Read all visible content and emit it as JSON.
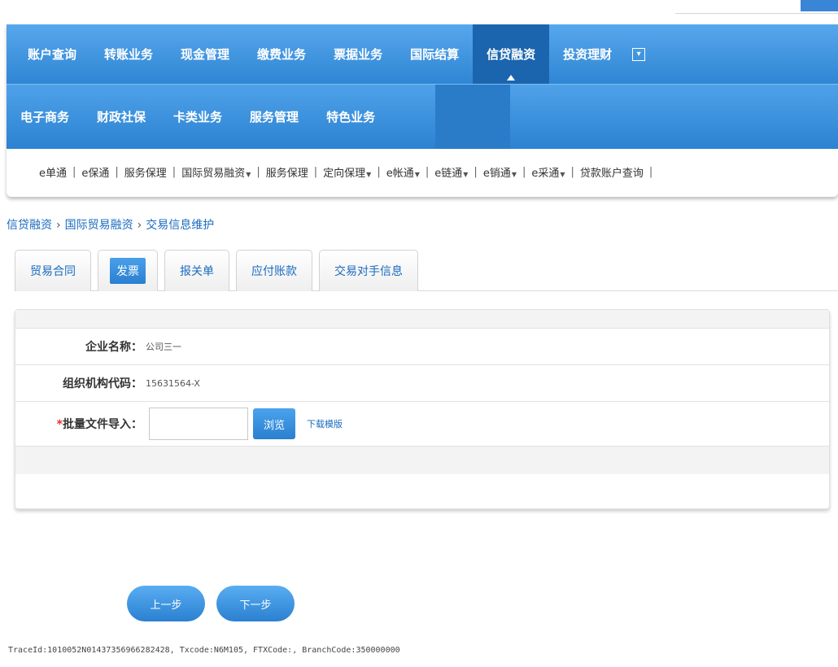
{
  "nav_primary": [
    "账户查询",
    "转账业务",
    "现金管理",
    "缴费业务",
    "票据业务",
    "国际结算",
    "信贷融资",
    "投资理财"
  ],
  "nav_primary_active": "信贷融资",
  "nav_secondary": [
    "电子商务",
    "财政社保",
    "卡类业务",
    "服务管理",
    "特色业务"
  ],
  "subnav": [
    {
      "label": "e单通",
      "dropdown": false
    },
    {
      "label": "e保通",
      "dropdown": false
    },
    {
      "label": "服务保理",
      "dropdown": false
    },
    {
      "label": "国际贸易融资",
      "dropdown": true
    },
    {
      "label": "服务保理",
      "dropdown": false
    },
    {
      "label": "定向保理",
      "dropdown": true
    },
    {
      "label": "e帐通",
      "dropdown": true
    },
    {
      "label": "e链通",
      "dropdown": true
    },
    {
      "label": "e销通",
      "dropdown": true
    },
    {
      "label": "e采通",
      "dropdown": true
    },
    {
      "label": "贷款账户查询",
      "dropdown": false
    }
  ],
  "breadcrumb": [
    "信贷融资",
    "国际贸易融资",
    "交易信息维护"
  ],
  "tabs": [
    "贸易合同",
    "发票",
    "报关单",
    "应付账款",
    "交易对手信息"
  ],
  "active_tab": "发票",
  "form": {
    "company_label": "企业名称：",
    "company_value": "公司三一",
    "org_code_label": "组织机构代码：",
    "org_code_value": "15631564-X",
    "required_mark": "*",
    "file_label": "批量文件导入：",
    "browse_label": "浏览",
    "download_label": "下载模版"
  },
  "buttons": {
    "prev": "上一步",
    "next": "下一步"
  },
  "trace": "TraceId:1010052N01437356966282428, Txcode:N6M105, FTXCode:, BranchCode:350000000",
  "colors": {
    "nav_blue": "#2f86d4",
    "active_nav": "#1b65ae",
    "link": "#1a6bbf"
  }
}
